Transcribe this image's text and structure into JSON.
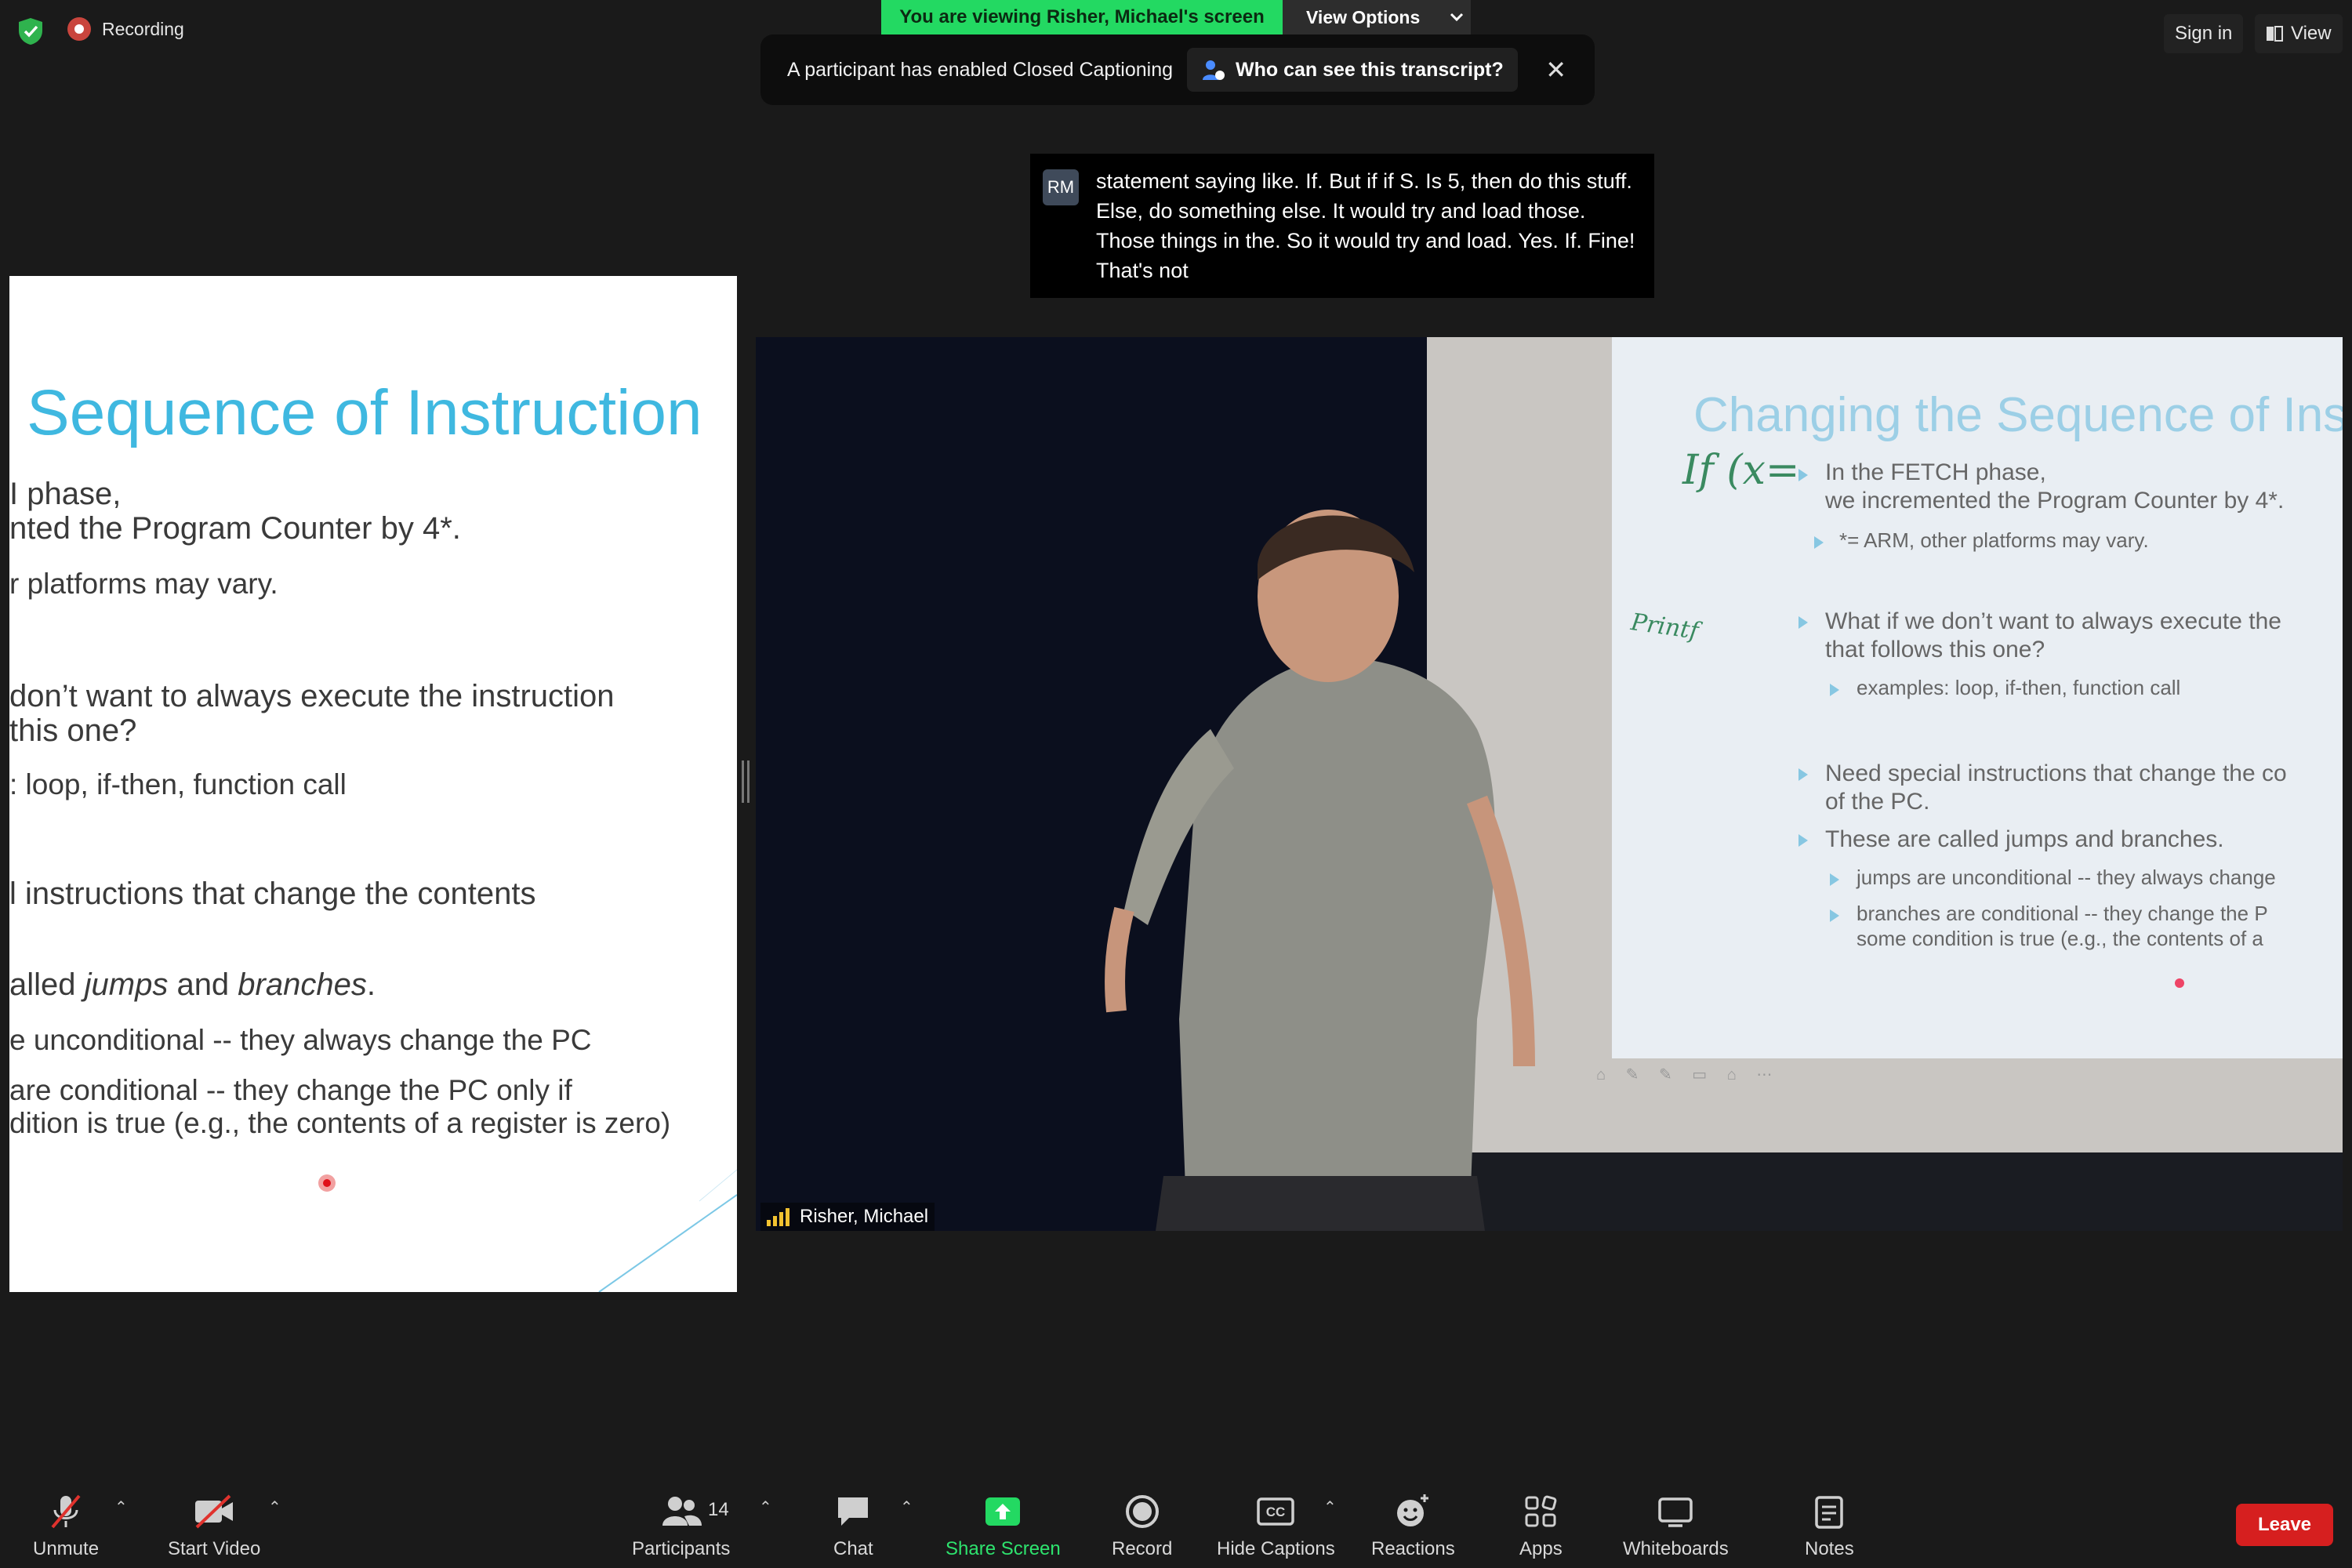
{
  "top_bar": {
    "recording_label": "Recording",
    "viewing_banner": "You are viewing Risher, Michael's screen",
    "view_options_label": "View Options",
    "sign_in_label": "Sign in",
    "view_label": "View"
  },
  "cc_notice": {
    "text": "A participant has enabled Closed Captioning",
    "button_label": "Who can see this transcript?",
    "close_symbol": "✕"
  },
  "caption": {
    "avatar_initials": "RM",
    "text": "statement saying like. If. But if if S. Is 5, then do this stuff. Else, do something else. It would try and load those. Those things in the. So it would try and load. Yes. If. Fine! That's not"
  },
  "shared_slide": {
    "title": "Sequence of Instruction",
    "lines": [
      "I phase,",
      "nted the Program Counter by 4*.",
      "r platforms may vary.",
      "don’t want to always execute the instruction",
      " this one?",
      ": loop, if-then, function call",
      "l instructions that change the contents",
      "alled ",
      "jumps",
      " and ",
      "branches",
      ".",
      "e unconditional -- they always change the PC",
      "are conditional -- they change the PC only if",
      "dition is true (e.g., the contents of a register is zero)"
    ]
  },
  "video_tile": {
    "participant_name": "Risher, Michael",
    "projected_slide": {
      "title": "Changing the Sequence of Ins",
      "handwriting_1": "If (x=",
      "handwriting_2": "Printf",
      "lines": [
        "In the FETCH phase,",
        "we incremented the Program Counter by 4*.",
        "*= ARM, other platforms may vary.",
        "What if we don’t want to always execute the",
        "that follows this one?",
        "examples: loop, if-then, function call",
        "Need special instructions that change the co",
        "of the PC.",
        "These are called jumps and branches.",
        "jumps are unconditional -- they always change",
        "branches are conditional -- they change the P",
        "some condition is true (e.g., the contents of a"
      ],
      "toolbar_glyphs": "⌂ ✎ ✎ ▭ ⌂ ⋯"
    }
  },
  "toolbar": {
    "unmute": "Unmute",
    "start_video": "Start Video",
    "participants": "Participants",
    "participant_count": "14",
    "chat": "Chat",
    "share_screen": "Share Screen",
    "record": "Record",
    "hide_captions": "Hide Captions",
    "cc_badge": "CC",
    "reactions": "Reactions",
    "apps": "Apps",
    "whiteboards": "Whiteboards",
    "notes": "Notes",
    "leave": "Leave"
  },
  "colors": {
    "viewing_banner": "#23d962",
    "share_screen": "#2ee36e",
    "leave": "#d61f1f",
    "slide_title": "#3fb8e0"
  }
}
